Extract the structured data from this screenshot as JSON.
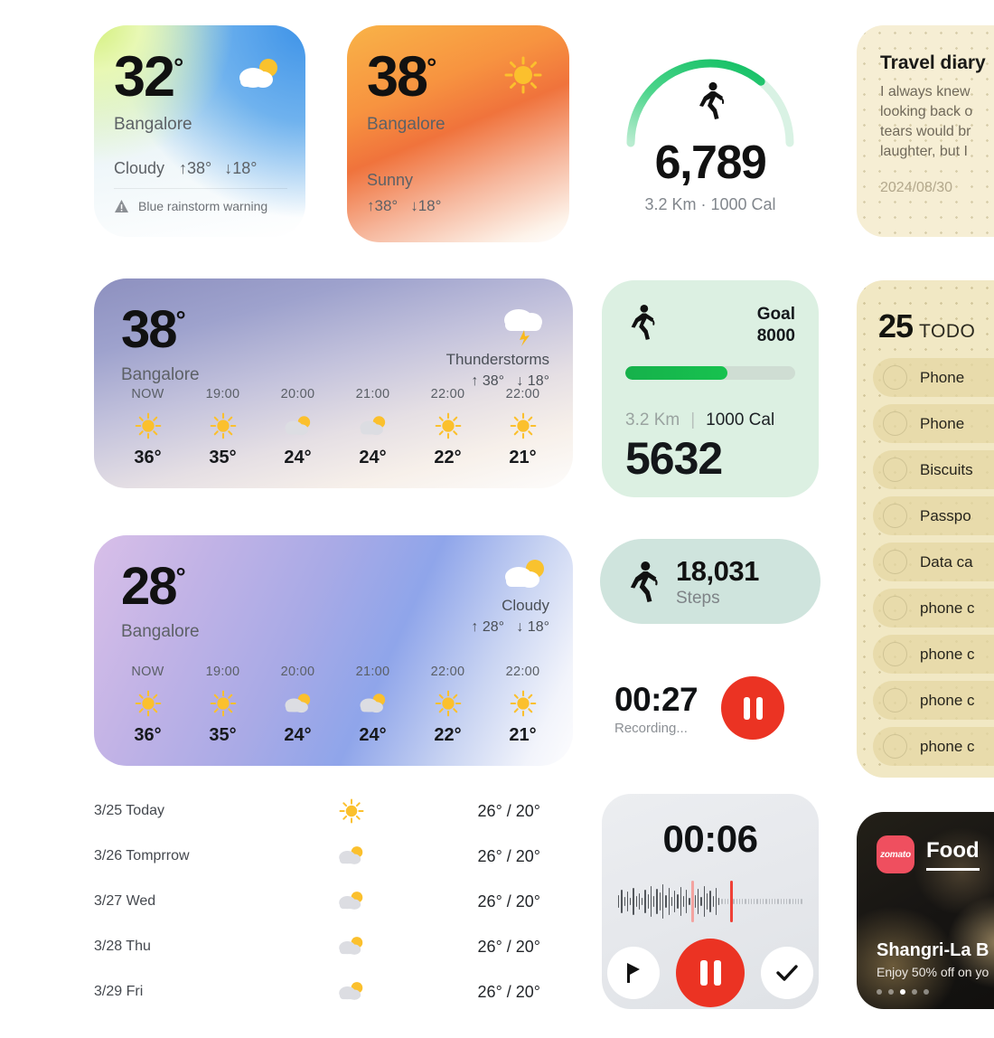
{
  "weather_small_1": {
    "temp": "32",
    "degree": "°",
    "city": "Bangalore",
    "condition": "Cloudy",
    "high": "↑38°",
    "low": "↓18°",
    "warning": "Blue rainstorm warning",
    "icon": "cloud-sun-icon"
  },
  "weather_small_2": {
    "temp": "38",
    "degree": "°",
    "city": "Bangalore",
    "condition": "Sunny",
    "high": "↑38°",
    "low": "↓18°",
    "icon": "sun-icon"
  },
  "weather_big_1": {
    "temp": "38",
    "degree": "°",
    "city": "Bangalore",
    "condition": "Thunderstorms",
    "high": "↑ 38°",
    "low": "↓ 18°",
    "icon": "cloud-lightning-icon",
    "hourly": [
      {
        "time": "NOW",
        "icon": "sun-icon",
        "temp": "36°"
      },
      {
        "time": "19:00",
        "icon": "sun-icon",
        "temp": "35°"
      },
      {
        "time": "20:00",
        "icon": "cloud-sun-icon",
        "temp": "24°"
      },
      {
        "time": "21:00",
        "icon": "cloud-sun-icon",
        "temp": "24°"
      },
      {
        "time": "22:00",
        "icon": "sun-icon",
        "temp": "22°"
      },
      {
        "time": "22:00",
        "icon": "sun-icon",
        "temp": "21°"
      }
    ]
  },
  "weather_big_2": {
    "temp": "28",
    "degree": "°",
    "city": "Bangalore",
    "condition": "Cloudy",
    "high": "↑ 28°",
    "low": "↓ 18°",
    "icon": "cloud-sun-icon",
    "hourly": [
      {
        "time": "NOW",
        "icon": "sun-icon",
        "temp": "36°"
      },
      {
        "time": "19:00",
        "icon": "sun-icon",
        "temp": "35°"
      },
      {
        "time": "20:00",
        "icon": "cloud-sun-icon",
        "temp": "24°"
      },
      {
        "time": "21:00",
        "icon": "cloud-sun-icon",
        "temp": "24°"
      },
      {
        "time": "22:00",
        "icon": "sun-icon",
        "temp": "22°"
      },
      {
        "time": "22:00",
        "icon": "sun-icon",
        "temp": "21°"
      }
    ]
  },
  "daily_forecast": [
    {
      "day": "3/25 Today",
      "icon": "sun-icon",
      "range": "26° / 20°"
    },
    {
      "day": "3/26 Tomprrow",
      "icon": "cloud-sun-icon",
      "range": "26° / 20°"
    },
    {
      "day": "3/27 Wed",
      "icon": "cloud-sun-icon",
      "range": "26° / 20°"
    },
    {
      "day": "3/28 Thu",
      "icon": "cloud-sun-icon",
      "range": "26° / 20°"
    },
    {
      "day": "3/29 Fri",
      "icon": "cloud-sun-icon",
      "range": "26° / 20°"
    }
  ],
  "steps_ring": {
    "steps": "6,789",
    "sub": "3.2 Km · 1000 Cal",
    "icon": "running-icon",
    "progress_percent": 72,
    "arc_color": "#19c56a"
  },
  "goal_card": {
    "goal_label": "Goal",
    "goal_value": "8000",
    "icon": "running-icon",
    "progress_percent": 60,
    "distance": "3.2 Km",
    "separator": "|",
    "calories": "1000 Cal",
    "steps": "5632",
    "bg_color": "#dcf0e2",
    "bar_color": "#16b14b"
  },
  "steps_pill": {
    "steps": "18,031",
    "label": "Steps",
    "icon": "running-icon",
    "bg_color": "#cfe4dd"
  },
  "recording_row": {
    "time": "00:27",
    "status": "Recording...",
    "button_icon": "pause-icon",
    "button_color": "#eb3323"
  },
  "voice_recorder": {
    "time": "00:06",
    "main_icon": "pause-icon",
    "left_icon": "marker-flag-icon",
    "right_icon": "check-icon",
    "main_color": "#eb3323"
  },
  "travel_diary": {
    "title": "Travel diary",
    "line1": "I always knew",
    "line2": "looking back o",
    "line3": "tears would br",
    "line4": "laughter, but I",
    "date": "2024/08/30",
    "bg_color": "#f6eed4"
  },
  "todo_card": {
    "count": "25",
    "word": "TODO",
    "bg_color": "#f1e8c4",
    "items": [
      {
        "label": "Phone",
        "checked": false
      },
      {
        "label": "Phone",
        "checked": false
      },
      {
        "label": "Biscuits",
        "checked": false
      },
      {
        "label": "Passpo",
        "checked": false
      },
      {
        "label": "Data ca",
        "checked": false
      },
      {
        "label": "phone c",
        "checked": false
      },
      {
        "label": "phone c",
        "checked": false
      },
      {
        "label": "phone c",
        "checked": false
      },
      {
        "label": "phone c",
        "checked": false
      }
    ]
  },
  "zomato_card": {
    "logo_text": "zomato",
    "tab": "Food",
    "title": "Shangri-La B",
    "subtitle": "Enjoy 50% off on yo",
    "dots_total": 5,
    "dots_active_index": 2,
    "accent_color": "#ef4f5f"
  }
}
